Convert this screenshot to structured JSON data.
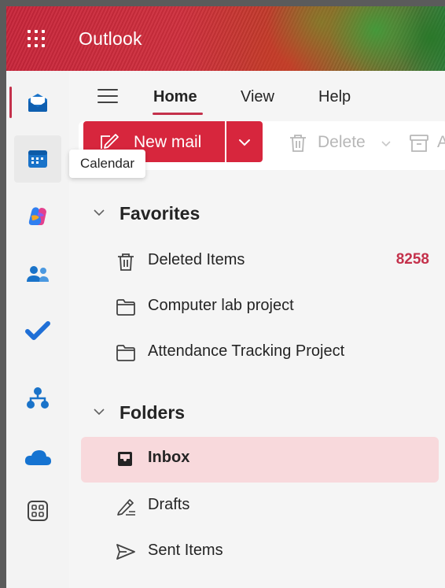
{
  "header": {
    "app_title": "Outlook"
  },
  "rail": {
    "items": [
      {
        "name": "mail",
        "icon": "mail-icon",
        "selected": true
      },
      {
        "name": "calendar",
        "icon": "calendar-icon",
        "hovered": true
      },
      {
        "name": "copilot",
        "icon": "copilot-icon"
      },
      {
        "name": "people",
        "icon": "people-icon"
      },
      {
        "name": "todo",
        "icon": "todo-check-icon"
      },
      {
        "name": "org-explorer",
        "icon": "org-chart-icon"
      },
      {
        "name": "onedrive",
        "icon": "cloud-icon"
      },
      {
        "name": "more-apps",
        "icon": "apps-grid-icon"
      }
    ]
  },
  "tooltip": {
    "text": "Calendar"
  },
  "tabs": [
    {
      "label": "Home",
      "active": true
    },
    {
      "label": "View"
    },
    {
      "label": "Help"
    }
  ],
  "ribbon": {
    "new_mail_label": "New mail",
    "delete_label": "Delete",
    "archive_label": "A"
  },
  "favorites": {
    "title": "Favorites",
    "items": [
      {
        "label": "Deleted Items",
        "icon": "trash-icon",
        "count": "8258"
      },
      {
        "label": "Computer lab project",
        "icon": "folder-icon",
        "count": ""
      },
      {
        "label": "Attendance Tracking Project",
        "icon": "folder-icon",
        "count": ""
      }
    ]
  },
  "folders": {
    "title": "Folders",
    "items": [
      {
        "label": "Inbox",
        "icon": "inbox-icon",
        "selected": true
      },
      {
        "label": "Drafts",
        "icon": "pencil-icon"
      },
      {
        "label": "Sent Items",
        "icon": "send-icon"
      }
    ]
  },
  "colors": {
    "accent": "#c4314b",
    "new_mail_bg": "#d7263d",
    "selected_folder_bg": "#f8d9dc"
  }
}
